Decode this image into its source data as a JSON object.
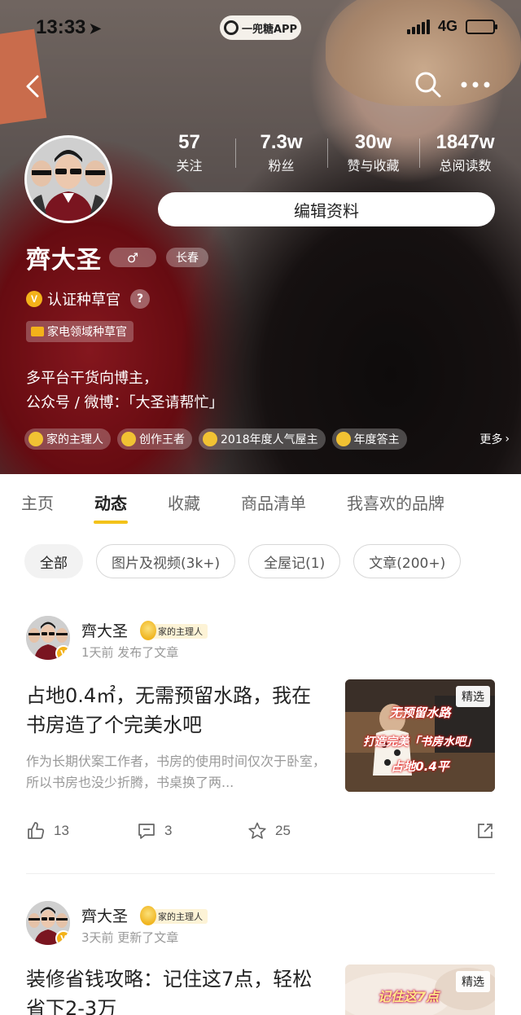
{
  "status_bar": {
    "time": "13:33",
    "app_pill": "一兜糖APP",
    "network": "4G",
    "location_icon": "location-arrow-icon",
    "battery_color": "#39c84a"
  },
  "profile": {
    "name": "齊大圣",
    "gender_symbol": "♂",
    "city": "长春",
    "verify_badge": "V",
    "verify_label": "认证种草官",
    "help_symbol": "?",
    "domain_tag": "家电领域种草官",
    "bio_line1": "多平台干货向博主，",
    "bio_line2": "公众号 / 微博：「大圣请帮忙」",
    "edit_button": "编辑资料",
    "stats": [
      {
        "num": "57",
        "label": "关注"
      },
      {
        "num": "7.3w",
        "label": "粉丝"
      },
      {
        "num": "30w",
        "label": "赞与收藏"
      },
      {
        "num": "1847w",
        "label": "总阅读数"
      }
    ],
    "honors": [
      "家的主理人",
      "创作王者",
      "2018年度人气屋主",
      "年度答主"
    ],
    "honors_more": "更多"
  },
  "tabs": [
    "主页",
    "动态",
    "收藏",
    "商品清单",
    "我喜欢的品牌"
  ],
  "active_tab": 1,
  "filters": [
    "全部",
    "图片及视频(3k+)",
    "全屋记(1)",
    "文章(200+)"
  ],
  "posts": [
    {
      "author": "齊大圣",
      "badge": "家的主理人",
      "meta": "1天前 发布了文章",
      "title": "占地0.4㎡，无需预留水路，我在书房造了个完美水吧",
      "excerpt": "作为长期伏案工作者，书房的使用时间仅次于卧室，所以书房也没少折腾，书桌换了两...",
      "thumb_tag": "精选",
      "thumb_lines": [
        "无预留水路",
        "打造完美「书房水吧」",
        "占地0.4平"
      ],
      "likes": "13",
      "comments": "3",
      "stars": "25"
    },
    {
      "author": "齊大圣",
      "badge": "家的主理人",
      "meta": "3天前 更新了文章",
      "title": "装修省钱攻略：记住这7点，轻松省下2-3万",
      "thumb_tag": "精选",
      "thumb_lines": [
        "记住这7点"
      ]
    }
  ],
  "colors": {
    "accent": "#f3c21a",
    "verify": "#f3b21a"
  }
}
